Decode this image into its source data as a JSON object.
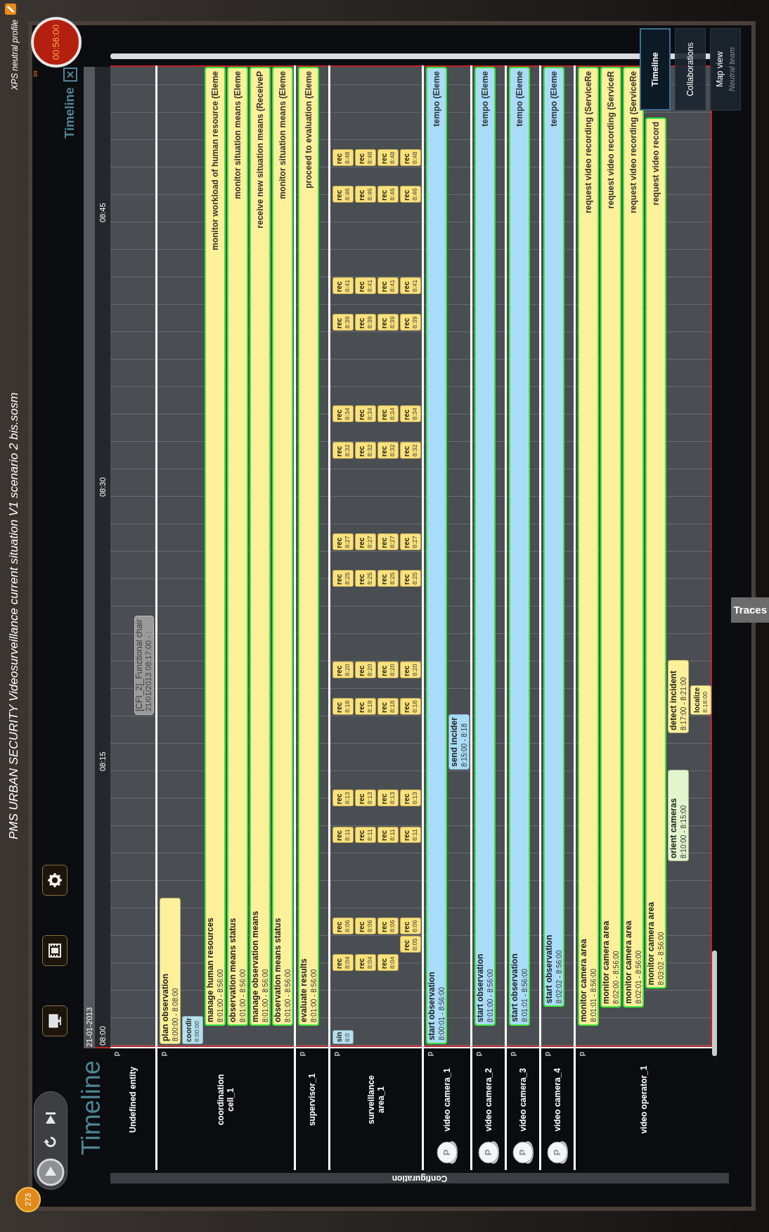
{
  "window": {
    "title": "PMS URBAN SECURITY Videosurveillance current situation V1 scenario 2 bis.sosm",
    "profile": "XPS neutral profile"
  },
  "clock": {
    "time": "00:56:00",
    "extra": "∞"
  },
  "badge": "273",
  "heading": "Timeline",
  "panel_title": "Timeline",
  "side_tab": "Configuration",
  "bottom_tab": "Traces",
  "view_tabs": [
    {
      "label": "Timeline",
      "selected": true
    },
    {
      "label": "Collaborations",
      "selected": false
    },
    {
      "label": "Map view",
      "sublabel": "Neutral team",
      "selected": false
    }
  ],
  "timeline": {
    "date": "21-01-2013",
    "ticks": [
      "08:00",
      "08:15",
      "08:30",
      "08:45"
    ],
    "entities": [
      {
        "name": "Undefined entity",
        "kind": "plain",
        "flag": "p",
        "tooltip": {
          "title": "[CFI_2]_Functional chair",
          "detail": "21/01/2013 08:17:00 - :"
        }
      },
      {
        "name": "coordination cell_1",
        "kind": "cell",
        "flag": "p",
        "tracks": [
          [
            {
              "kind": "bar",
              "title": "plan observation",
              "times": "8:00:00 - 8:08:00",
              "color": "#fdf09a",
              "active": false
            }
          ],
          [
            {
              "kind": "chip",
              "title": "coordir",
              "times": "8:00:00",
              "color": "#b5e1ee",
              "active": false
            }
          ],
          [
            {
              "kind": "bar",
              "title": "manage human resources",
              "times": "8:01:00 - 8:56:00",
              "end_label": "monitor workload of human resource (Eleme",
              "color": "#fdf09a",
              "active": true
            }
          ],
          [
            {
              "kind": "bar",
              "title": "observation means status",
              "times": "8:01:00 - 8:56:00",
              "end_label": "monitor situation means (Eleme",
              "color": "#fdf09a",
              "active": true
            }
          ],
          [
            {
              "kind": "bar",
              "title": "manage observation means",
              "times": "8:01:00 - 8:56:00",
              "end_label": "receive new situation means (ReceiveP",
              "color": "#fdf09a",
              "active": true
            }
          ],
          [
            {
              "kind": "bar",
              "title": "observation means status",
              "times": "8:01:00 - 8:56:00",
              "end_label": "monitor situation means (Eleme",
              "color": "#fdf09a",
              "active": true
            }
          ]
        ]
      },
      {
        "name": "supervisor_1",
        "kind": "person",
        "flag": "p",
        "tracks": [
          [
            {
              "kind": "bar",
              "title": "evaluate results",
              "times": "8:01:00 - 8:56:00",
              "end_label": "proceed to evaluation (Eleme",
              "color": "#fdf09a",
              "active": true
            }
          ]
        ]
      },
      {
        "name": "surveillance area_1",
        "kind": "cell",
        "flag": "p",
        "tracks": [
          [
            {
              "kind": "chip",
              "title": "sin",
              "times": "8:0",
              "color": "#b5e1ee",
              "active": false
            },
            {
              "kind": "chip",
              "title": "rec",
              "times": "8:04",
              "color": "#fbe27a",
              "active": false
            },
            {
              "kind": "chip",
              "title": "rec",
              "times": "8:06",
              "color": "#fbe27a",
              "active": false
            },
            {
              "kind": "chip",
              "title": "rec",
              "times": "8:11",
              "color": "#fbe27a",
              "active": false
            },
            {
              "kind": "chip",
              "title": "rec",
              "times": "8:13",
              "color": "#fbe27a",
              "active": false
            },
            {
              "kind": "chip",
              "title": "rec",
              "times": "8:18",
              "color": "#fbe27a",
              "active": false
            },
            {
              "kind": "chip",
              "title": "rec",
              "times": "8:20",
              "color": "#fbe27a",
              "active": false
            },
            {
              "kind": "chip",
              "title": "rec",
              "times": "8:25",
              "color": "#fbe27a",
              "active": false
            },
            {
              "kind": "chip",
              "title": "rec",
              "times": "8:27",
              "color": "#fbe27a",
              "active": false
            },
            {
              "kind": "chip",
              "title": "rec",
              "times": "8:32",
              "color": "#fbe27a",
              "active": false
            },
            {
              "kind": "chip",
              "title": "rec",
              "times": "8:34",
              "color": "#fbe27a",
              "active": false
            },
            {
              "kind": "chip",
              "title": "rec",
              "times": "8:39",
              "color": "#fbe27a",
              "active": false
            },
            {
              "kind": "chip",
              "title": "rec",
              "times": "8:41",
              "color": "#fbe27a",
              "active": false
            },
            {
              "kind": "chip",
              "title": "rec",
              "times": "8:46",
              "color": "#fbe27a",
              "active": false
            },
            {
              "kind": "chip",
              "title": "rec",
              "times": "8:48",
              "color": "#fbe27a",
              "active": false
            }
          ],
          [
            {
              "kind": "chip",
              "title": "rec",
              "times": "8:04",
              "color": "#fbe27a",
              "active": false
            },
            {
              "kind": "chip",
              "title": "rec",
              "times": "8:06",
              "color": "#fbe27a",
              "active": false
            },
            {
              "kind": "chip",
              "title": "rec",
              "times": "8:11",
              "color": "#fbe27a",
              "active": false
            },
            {
              "kind": "chip",
              "title": "rec",
              "times": "8:13",
              "color": "#fbe27a",
              "active": false
            },
            {
              "kind": "chip",
              "title": "rec",
              "times": "8:18",
              "color": "#fbe27a",
              "active": false
            },
            {
              "kind": "chip",
              "title": "rec",
              "times": "8:20",
              "color": "#fbe27a",
              "active": false
            },
            {
              "kind": "chip",
              "title": "rec",
              "times": "8:25",
              "color": "#fbe27a",
              "active": false
            },
            {
              "kind": "chip",
              "title": "rec",
              "times": "8:27",
              "color": "#fbe27a",
              "active": false
            },
            {
              "kind": "chip",
              "title": "rec",
              "times": "8:32",
              "color": "#fbe27a",
              "active": false
            },
            {
              "kind": "chip",
              "title": "rec",
              "times": "8:34",
              "color": "#fbe27a",
              "active": false
            },
            {
              "kind": "chip",
              "title": "rec",
              "times": "8:39",
              "color": "#fbe27a",
              "active": false
            },
            {
              "kind": "chip",
              "title": "rec",
              "times": "8:41",
              "color": "#fbe27a",
              "active": false
            },
            {
              "kind": "chip",
              "title": "rec",
              "times": "8:46",
              "color": "#fbe27a",
              "active": false
            },
            {
              "kind": "chip",
              "title": "rec",
              "times": "8:48",
              "color": "#fbe27a",
              "active": false
            }
          ],
          [
            {
              "kind": "chip",
              "title": "rec",
              "times": "8:04",
              "color": "#fbe27a",
              "active": false
            },
            {
              "kind": "chip",
              "title": "rec",
              "times": "8:06",
              "color": "#fbe27a",
              "active": false
            },
            {
              "kind": "chip",
              "title": "rec",
              "times": "8:11",
              "color": "#fbe27a",
              "active": false
            },
            {
              "kind": "chip",
              "title": "rec",
              "times": "8:13",
              "color": "#fbe27a",
              "active": false
            },
            {
              "kind": "chip",
              "title": "rec",
              "times": "8:18",
              "color": "#fbe27a",
              "active": false
            },
            {
              "kind": "chip",
              "title": "rec",
              "times": "8:20",
              "color": "#fbe27a",
              "active": false
            },
            {
              "kind": "chip",
              "title": "rec",
              "times": "8:25",
              "color": "#fbe27a",
              "active": false
            },
            {
              "kind": "chip",
              "title": "rec",
              "times": "8:27",
              "color": "#fbe27a",
              "active": false
            },
            {
              "kind": "chip",
              "title": "rec",
              "times": "8:32",
              "color": "#fbe27a",
              "active": false
            },
            {
              "kind": "chip",
              "title": "rec",
              "times": "8:34",
              "color": "#fbe27a",
              "active": false
            },
            {
              "kind": "chip",
              "title": "rec",
              "times": "8:39",
              "color": "#fbe27a",
              "active": false
            },
            {
              "kind": "chip",
              "title": "rec",
              "times": "8:41",
              "color": "#fbe27a",
              "active": false
            },
            {
              "kind": "chip",
              "title": "rec",
              "times": "8:46",
              "color": "#fbe27a",
              "active": false
            },
            {
              "kind": "chip",
              "title": "rec",
              "times": "8:48",
              "color": "#fbe27a",
              "active": false
            }
          ],
          [
            {
              "kind": "chip",
              "title": "rec",
              "times": "8:05",
              "color": "#fbe27a",
              "active": false
            },
            {
              "kind": "chip",
              "title": "rec",
              "times": "8:06",
              "color": "#fbe27a",
              "active": false
            },
            {
              "kind": "chip",
              "title": "rec",
              "times": "8:11",
              "color": "#fbe27a",
              "active": false
            },
            {
              "kind": "chip",
              "title": "rec",
              "times": "8:13",
              "color": "#fbe27a",
              "active": false
            },
            {
              "kind": "chip",
              "title": "rec",
              "times": "8:18",
              "color": "#fbe27a",
              "active": false
            },
            {
              "kind": "chip",
              "title": "rec",
              "times": "8:20",
              "color": "#fbe27a",
              "active": false
            },
            {
              "kind": "chip",
              "title": "rec",
              "times": "8:25",
              "color": "#fbe27a",
              "active": false
            },
            {
              "kind": "chip",
              "title": "rec",
              "times": "8:27",
              "color": "#fbe27a",
              "active": false
            },
            {
              "kind": "chip",
              "title": "rec",
              "times": "8:32",
              "color": "#fbe27a",
              "active": false
            },
            {
              "kind": "chip",
              "title": "rec",
              "times": "8:34",
              "color": "#fbe27a",
              "active": false
            },
            {
              "kind": "chip",
              "title": "rec",
              "times": "8:39",
              "color": "#fbe27a",
              "active": false
            },
            {
              "kind": "chip",
              "title": "rec",
              "times": "8:41",
              "color": "#fbe27a",
              "active": false
            },
            {
              "kind": "chip",
              "title": "rec",
              "times": "8:46",
              "color": "#fbe27a",
              "active": false
            },
            {
              "kind": "chip",
              "title": "rec",
              "times": "8:48",
              "color": "#fbe27a",
              "active": false
            }
          ]
        ]
      },
      {
        "name": "video camera_1",
        "kind": "camera",
        "icon_letter": "P",
        "flag": "p",
        "tracks": [
          [
            {
              "kind": "bar",
              "title": "start observation",
              "times": "8:00:01 - 8:56:00",
              "end_label": "tempo (Eleme",
              "color": "#a9dcf8",
              "active": true
            }
          ],
          [
            {
              "kind": "bar",
              "title": "send incider",
              "times": "8:15:00 - 8:18",
              "color": "#a9dcf8",
              "active": false
            }
          ]
        ]
      },
      {
        "name": "video camera_2",
        "kind": "camera",
        "icon_letter": "P",
        "flag": "p",
        "tracks": [
          [
            {
              "kind": "bar",
              "title": "start observation",
              "times": "8:01:00 - 8:56:00",
              "end_label": "tempo (Eleme",
              "color": "#a9dcf8",
              "active": true
            }
          ]
        ]
      },
      {
        "name": "video camera_3",
        "kind": "camera",
        "icon_letter": "P",
        "flag": "p",
        "tracks": [
          [
            {
              "kind": "bar",
              "title": "start observation",
              "times": "8:01:01 - 8:56:00",
              "end_label": "tempo (Eleme",
              "color": "#a9dcf8",
              "active": true
            }
          ]
        ]
      },
      {
        "name": "video camera_4",
        "kind": "camera",
        "icon_letter": "P",
        "flag": "p",
        "tracks": [
          [
            {
              "kind": "bar",
              "title": "start observation",
              "times": "8:02:02 - 8:56:00",
              "end_label": "tempo (Eleme",
              "color": "#a9dcf8",
              "active": true
            }
          ]
        ]
      },
      {
        "name": "video operator_1",
        "kind": "person",
        "flag": "p",
        "tracks": [
          [
            {
              "kind": "bar",
              "title": "monitor camera area",
              "times": "8:01:01 - 8:56:00",
              "end_label": "request video recording (ServiceRe",
              "color": "#fdf09a",
              "active": true
            }
          ],
          [
            {
              "kind": "bar",
              "title": "monitor camera area",
              "times": "8:02:00 - 8:56:00",
              "end_label": "request video recording (ServiceR",
              "color": "#fdf09a",
              "active": true
            }
          ],
          [
            {
              "kind": "bar",
              "title": "monitor camera area",
              "times": "8:02:01 - 8:56:00",
              "end_label": "request video recording (ServiceRe",
              "color": "#fdf09a",
              "active": true
            }
          ],
          [
            {
              "kind": "bar",
              "title": "monitor camera area",
              "times": "8:03:02 - 8:56:00",
              "end_label": "request video record",
              "color": "#fdf09a",
              "active": true
            }
          ],
          [
            {
              "kind": "bar",
              "title": "orient cameras",
              "times": "8:10:00 - 8:15:00",
              "color": "#e2f5cc",
              "active": false
            },
            {
              "kind": "bar",
              "title": "detect incident",
              "times": "8:17:00 - 8:21:00",
              "color": "#fdf09a",
              "active": false
            }
          ],
          [
            {
              "kind": "chip",
              "title": "localize",
              "times": "8:18:00",
              "color": "#fdf09a",
              "active": false
            }
          ]
        ]
      }
    ]
  }
}
